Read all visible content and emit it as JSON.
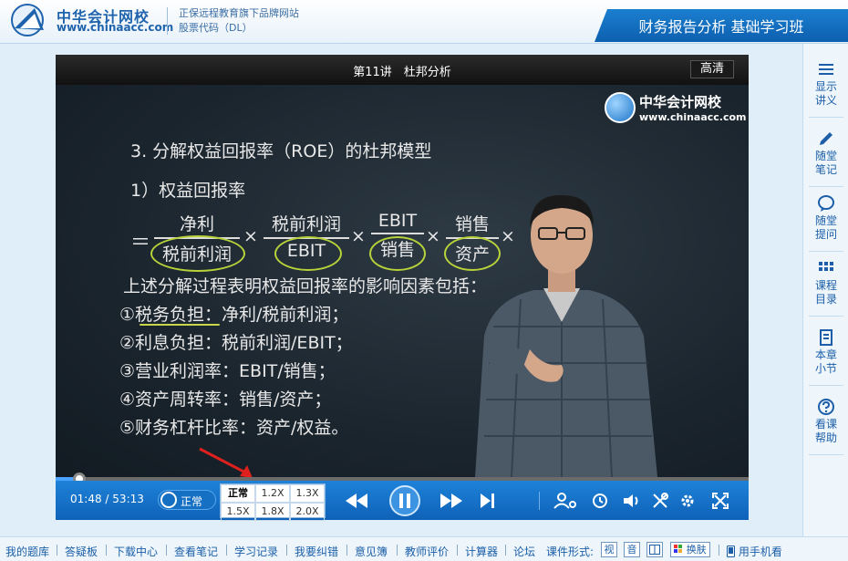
{
  "header": {
    "brand": "中华会计网校",
    "url": "www.chinaacc.com",
    "tagline": "正保远程教育旗下品牌网站",
    "stock": "股票代码（DL）",
    "course_title": "财务报告分析 基础学习班"
  },
  "player": {
    "video_title": "第11讲　杜邦分析",
    "quality_label": "高清",
    "watermark_brand": "中华会计网校",
    "watermark_url": "www.chinaacc.com",
    "slide": {
      "heading": "3. 分解权益回报率（ROE）的杜邦模型",
      "subheading": "1）权益回报率",
      "equals": "＝",
      "times": "×",
      "fractions": [
        {
          "num": "净利",
          "den": "税前利润"
        },
        {
          "num": "税前利润",
          "den": "EBIT"
        },
        {
          "num": "EBIT",
          "den": "销售"
        },
        {
          "num": "销售",
          "den": "资产"
        }
      ],
      "intro": "上述分解过程表明权益回报率的影响因素包括：",
      "items": [
        "①税务负担：净利/税前利润；",
        "②利息负担：税前利润/EBIT；",
        "③营业利润率：EBIT/销售；",
        "④资产周转率：销售/资产；",
        "⑤财务杠杆比率：资产/权益。"
      ]
    },
    "progress_fraction": 0.034,
    "current_time": "01:48",
    "separator": "/",
    "total_time": "53:13",
    "speed_label": "正常",
    "speed_options": [
      "正常",
      "1.2X",
      "1.3X",
      "1.5X",
      "1.8X",
      "2.0X"
    ]
  },
  "sidebar": {
    "items": [
      {
        "label1": "显示",
        "label2": "讲义",
        "icon": "menu-icon"
      },
      {
        "label1": "随堂",
        "label2": "笔记",
        "icon": "pencil-icon"
      },
      {
        "label1": "随堂",
        "label2": "提问",
        "icon": "speech-bubble-icon"
      },
      {
        "label1": "课程",
        "label2": "目录",
        "icon": "grid-icon"
      },
      {
        "label1": "本章",
        "label2": "小节",
        "icon": "document-icon"
      },
      {
        "label1": "看课",
        "label2": "帮助",
        "icon": "help-icon"
      }
    ]
  },
  "footer": {
    "links": [
      "我的题库",
      "答疑板",
      "下载中心",
      "查看笔记",
      "学习记录",
      "我要纠错",
      "意见簿",
      "教师评价",
      "计算器",
      "论坛"
    ],
    "mode_label": "课件形式:",
    "mode_video": "视",
    "mode_audio": "音",
    "skin_label": "换肤",
    "mobile_label": "用手机看"
  },
  "colors": {
    "accent": "#1b7fd0",
    "control_bar": "#1570c4",
    "highlight_oval": "#b8d33a",
    "annotation_arrow": "#e0201c"
  }
}
